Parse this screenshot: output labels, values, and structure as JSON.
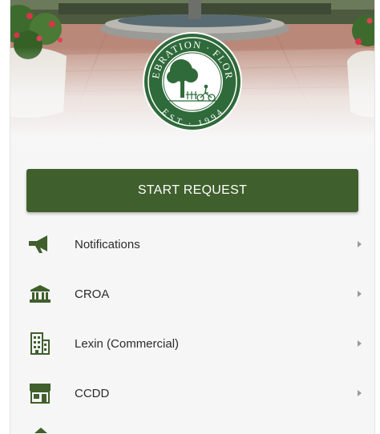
{
  "header": {
    "seal_text_top": "CELEBRATION · FLORIDA",
    "seal_text_bottom": "EST · 1994"
  },
  "start_button": {
    "label": "START REQUEST"
  },
  "menu": {
    "items": [
      {
        "label": "Notifications",
        "icon": "megaphone-icon"
      },
      {
        "label": "CROA",
        "icon": "building-columns-icon"
      },
      {
        "label": "Lexin (Commercial)",
        "icon": "office-building-icon"
      },
      {
        "label": "CCDD",
        "icon": "storefront-icon"
      }
    ]
  },
  "colors": {
    "brand_green": "#3f5f2c",
    "icon_green": "#3f5f2c",
    "chevron": "#9a9a9a",
    "list_background": "#f6f6f6"
  }
}
